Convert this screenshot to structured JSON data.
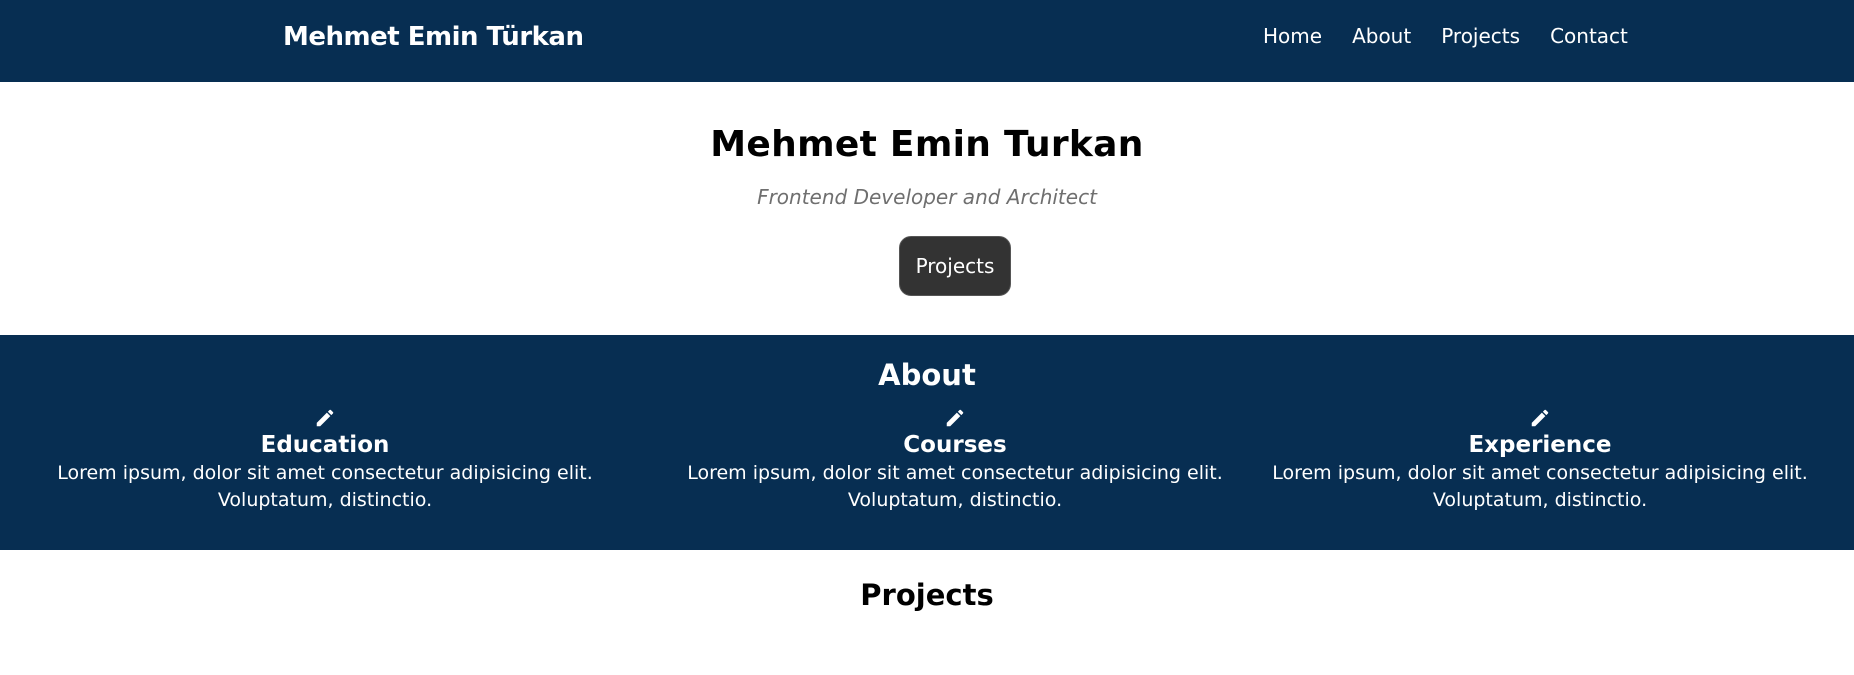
{
  "header": {
    "brand": "Mehmet Emin Türkan",
    "nav": [
      "Home",
      "About",
      "Projects",
      "Contact"
    ]
  },
  "hero": {
    "title": "Mehmet Emin Turkan",
    "subtitle": "Frontend Developer and Architect",
    "button_label": "Projects"
  },
  "about": {
    "title": "About",
    "columns": [
      {
        "icon": "pencil-icon",
        "title": "Education",
        "text": "Lorem ipsum, dolor sit amet consectetur adipisicing elit. Voluptatum, distinctio."
      },
      {
        "icon": "pencil-icon",
        "title": "Courses",
        "text": "Lorem ipsum, dolor sit amet consectetur adipisicing elit. Voluptatum, distinctio."
      },
      {
        "icon": "pencil-icon",
        "title": "Experience",
        "text": "Lorem ipsum, dolor sit amet consectetur adipisicing elit. Voluptatum, distinctio."
      }
    ]
  },
  "projects": {
    "title": "Projects"
  },
  "colors": {
    "primary": "#072e52",
    "button": "#333333",
    "subtitle": "#6f6f6f"
  }
}
